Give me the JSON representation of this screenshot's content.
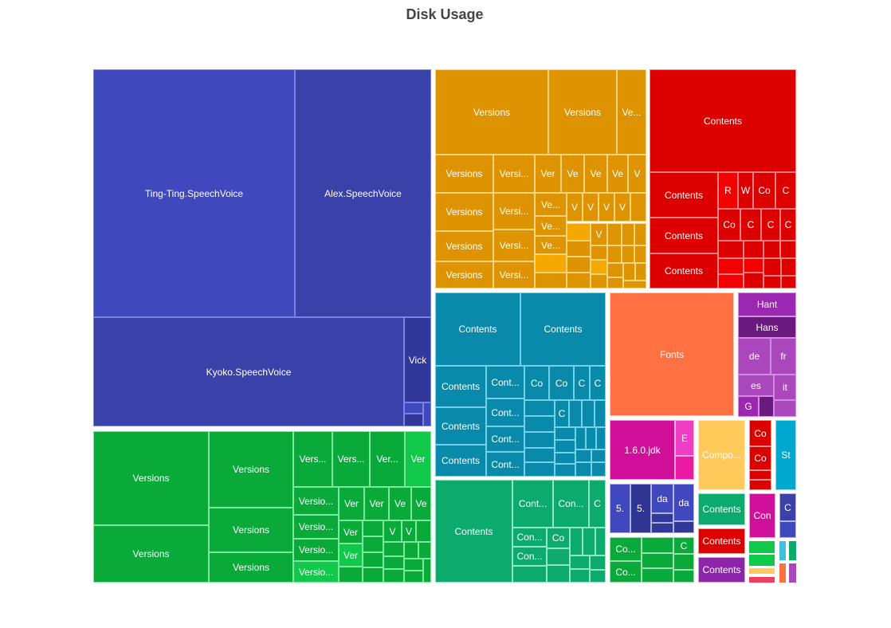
{
  "chart_data": {
    "type": "treemap",
    "title": "Disk Usage",
    "groups": [
      {
        "name": "voices",
        "color": "#3f48bd",
        "border": "#7b85e0",
        "children": [
          {
            "label": "Ting-Ting.SpeechVoice",
            "color": "#3f48bd"
          },
          {
            "label": "Alex.SpeechVoice",
            "color": "#3a42aa"
          },
          {
            "label": "Kyoko.SpeechVoice",
            "color": "#3a42aa"
          },
          {
            "label": "Vick",
            "color": "#32389a"
          },
          {
            "label": "",
            "color": "#3a42aa"
          },
          {
            "label": "",
            "color": "#32389a"
          },
          {
            "label": "",
            "color": "#3a42aa"
          }
        ]
      },
      {
        "name": "orange-versions",
        "color": "#de9400",
        "border": "#ffd37a",
        "children": [
          {
            "label": "Versions"
          },
          {
            "label": "Versions"
          },
          {
            "label": "Ve..."
          },
          {
            "label": "Versions"
          },
          {
            "label": "Versi..."
          },
          {
            "label": "Ver"
          },
          {
            "label": "Ve"
          },
          {
            "label": "Ve"
          },
          {
            "label": "Ve"
          },
          {
            "label": "V"
          },
          {
            "label": "Versions"
          },
          {
            "label": "Versi..."
          },
          {
            "label": "Ve..."
          },
          {
            "label": "V"
          },
          {
            "label": "V"
          },
          {
            "label": "V"
          },
          {
            "label": "V"
          },
          {
            "label": "Versions"
          },
          {
            "label": "Versi..."
          },
          {
            "label": "Ve..."
          },
          {
            "label": "Ve..."
          },
          {
            "label": "V"
          },
          {
            "label": "Versions"
          },
          {
            "label": "Versi..."
          }
        ]
      },
      {
        "name": "red-contents",
        "color": "#dd0000",
        "border": "#ff8080",
        "children": [
          {
            "label": "Contents"
          },
          {
            "label": "Contents"
          },
          {
            "label": "R"
          },
          {
            "label": "W"
          },
          {
            "label": "Co"
          },
          {
            "label": "C"
          },
          {
            "label": "Contents"
          },
          {
            "label": "Co"
          },
          {
            "label": "C"
          },
          {
            "label": "C"
          },
          {
            "label": "C"
          },
          {
            "label": "Contents"
          }
        ]
      },
      {
        "name": "teal-contents",
        "color": "#0a8aaa",
        "border": "#72d2ea",
        "children": [
          {
            "label": "Contents"
          },
          {
            "label": "Contents"
          },
          {
            "label": "Contents"
          },
          {
            "label": "Cont..."
          },
          {
            "label": "Co"
          },
          {
            "label": "Co"
          },
          {
            "label": "C"
          },
          {
            "label": "C"
          },
          {
            "label": "Cont..."
          },
          {
            "label": "C"
          },
          {
            "label": "Contents"
          },
          {
            "label": "Cont..."
          },
          {
            "label": "Contents"
          },
          {
            "label": "Cont..."
          }
        ]
      },
      {
        "name": "fonts",
        "color": "#ff7043",
        "children": [
          {
            "label": "Fonts"
          }
        ]
      },
      {
        "name": "purple-lang",
        "color": "#9c27b0",
        "border": "#d48ae0",
        "children": [
          {
            "label": "Hant"
          },
          {
            "label": "Hans"
          },
          {
            "label": "de"
          },
          {
            "label": "fr"
          },
          {
            "label": "es"
          },
          {
            "label": "it"
          },
          {
            "label": "G"
          }
        ]
      },
      {
        "name": "green-versions",
        "color": "#0aaa3a",
        "border": "#7be89a",
        "children": [
          {
            "label": "Versions"
          },
          {
            "label": "Versions"
          },
          {
            "label": "Vers..."
          },
          {
            "label": "Vers..."
          },
          {
            "label": "Ver..."
          },
          {
            "label": "Ver"
          },
          {
            "label": "Versio..."
          },
          {
            "label": "Ver"
          },
          {
            "label": "Ver"
          },
          {
            "label": "Ve"
          },
          {
            "label": "Ve"
          },
          {
            "label": "Versions"
          },
          {
            "label": "Versio..."
          },
          {
            "label": "Ver"
          },
          {
            "label": "V"
          },
          {
            "label": "V"
          },
          {
            "label": "Versions"
          },
          {
            "label": "Versions"
          },
          {
            "label": "Versio..."
          },
          {
            "label": "Ver"
          },
          {
            "label": "Versio..."
          }
        ]
      },
      {
        "name": "seagreen-contents",
        "color": "#0daa6e",
        "border": "#8ee8c4",
        "children": [
          {
            "label": "Contents"
          },
          {
            "label": "Cont..."
          },
          {
            "label": "Con..."
          },
          {
            "label": "C"
          },
          {
            "label": "Con..."
          },
          {
            "label": "Co"
          },
          {
            "label": "Con..."
          }
        ]
      },
      {
        "name": "jdk",
        "color": "#d0109a",
        "children": [
          {
            "label": "1.6.0.jdk"
          },
          {
            "label": "E"
          }
        ]
      },
      {
        "name": "compo",
        "color": "#ffca5a",
        "children": [
          {
            "label": "Compo..."
          }
        ]
      },
      {
        "name": "small-red",
        "color": "#dd0000",
        "children": [
          {
            "label": "Co"
          },
          {
            "label": "Co"
          }
        ]
      },
      {
        "name": "st",
        "color": "#00a8d0",
        "children": [
          {
            "label": "St"
          }
        ]
      },
      {
        "name": "blue-5",
        "color": "#3f48bd",
        "children": [
          {
            "label": "5."
          },
          {
            "label": "5."
          },
          {
            "label": "da"
          },
          {
            "label": "da"
          }
        ]
      },
      {
        "name": "contents-green",
        "color": "#0daa6e",
        "children": [
          {
            "label": "Contents"
          }
        ]
      },
      {
        "name": "contents-red",
        "color": "#dd0000",
        "children": [
          {
            "label": "Contents"
          }
        ]
      },
      {
        "name": "contents-purple",
        "color": "#8e24aa",
        "children": [
          {
            "label": "Contents"
          }
        ]
      },
      {
        "name": "con-magenta",
        "color": "#d0109a",
        "children": [
          {
            "label": "Con"
          }
        ]
      },
      {
        "name": "c-blue",
        "color": "#3a42aa",
        "children": [
          {
            "label": "C"
          }
        ]
      },
      {
        "name": "green-co",
        "color": "#0aaa3a",
        "children": [
          {
            "label": "Co..."
          },
          {
            "label": "Co..."
          },
          {
            "label": "C"
          }
        ]
      }
    ]
  }
}
